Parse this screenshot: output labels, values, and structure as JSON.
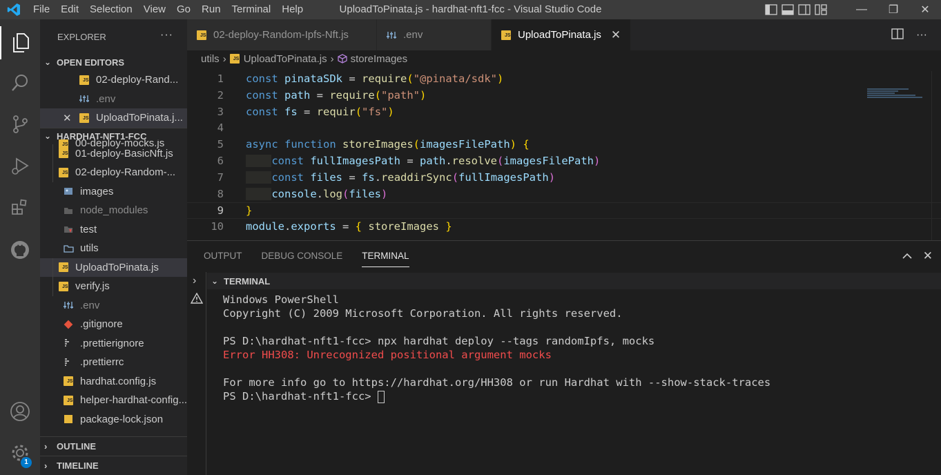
{
  "titlebar": {
    "menu": [
      "File",
      "Edit",
      "Selection",
      "View",
      "Go",
      "Run",
      "Terminal",
      "Help"
    ],
    "title": "UploadToPinata.js - hardhat-nft1-fcc - Visual Studio Code"
  },
  "activitybar": {
    "items": [
      "explorer-icon",
      "search-icon",
      "source-control-icon",
      "run-debug-icon",
      "extensions-icon",
      "github-icon"
    ],
    "settings_badge": "1"
  },
  "sidebar": {
    "header": "EXPLORER",
    "more": "···",
    "open_editors": {
      "title": "OPEN EDITORS",
      "items": [
        {
          "label": "02-deploy-Rand...",
          "type": "js"
        },
        {
          "label": ".env",
          "type": "env"
        },
        {
          "label": "UploadToPinata.j...",
          "type": "js"
        }
      ]
    },
    "project": {
      "title": "HARDHAT-NFT1-FCC",
      "items": [
        {
          "label": "00-deploy-mocks.js",
          "type": "js"
        },
        {
          "label": "01-deploy-BasicNft.js",
          "type": "js"
        },
        {
          "label": "02-deploy-Random-...",
          "type": "js"
        },
        {
          "label": "images",
          "type": "folder"
        },
        {
          "label": "node_modules",
          "type": "folder"
        },
        {
          "label": "test",
          "type": "folder-test"
        },
        {
          "label": "utils",
          "type": "folder-open"
        },
        {
          "label": "UploadToPinata.js",
          "type": "js"
        },
        {
          "label": "verify.js",
          "type": "js"
        },
        {
          "label": ".env",
          "type": "env"
        },
        {
          "label": ".gitignore",
          "type": "git"
        },
        {
          "label": ".prettierignore",
          "type": "prettier"
        },
        {
          "label": ".prettierrc",
          "type": "prettier"
        },
        {
          "label": "hardhat.config.js",
          "type": "js"
        },
        {
          "label": "helper-hardhat-config...",
          "type": "js"
        },
        {
          "label": "package-lock.json",
          "type": "json"
        }
      ]
    },
    "outline": "OUTLINE",
    "timeline": "TIMELINE"
  },
  "editor": {
    "tabs": [
      {
        "label": "02-deploy-Random-Ipfs-Nft.js",
        "type": "js"
      },
      {
        "label": ".env",
        "type": "env"
      },
      {
        "label": "UploadToPinata.js",
        "type": "js",
        "close": "✕"
      }
    ],
    "breadcrumb": {
      "folder": "utils",
      "file": "UploadToPinata.js",
      "symbol": "storeImages"
    },
    "line_numbers": [
      "1",
      "2",
      "3",
      "4",
      "5",
      "6",
      "7",
      "8",
      "9",
      "10"
    ]
  },
  "panel": {
    "tabs": [
      "OUTPUT",
      "DEBUG CONSOLE",
      "TERMINAL"
    ],
    "terminal_title": "TERMINAL",
    "lines": [
      "Windows PowerShell",
      "Copyright (C) 2009 Microsoft Corporation. All rights reserved.",
      "",
      "PS D:\\hardhat-nft1-fcc> npx hardhat deploy --tags randomIpfs, mocks",
      "Error HH308: Unrecognized positional argument mocks",
      "",
      "For more info go to https://hardhat.org/HH308 or run Hardhat with --show-stack-traces"
    ],
    "prompt": "PS D:\\hardhat-nft1-fcc> "
  },
  "colors": {
    "accent": "#007acc",
    "js_icon": "#e8b83b",
    "error": "#f14c4c"
  }
}
